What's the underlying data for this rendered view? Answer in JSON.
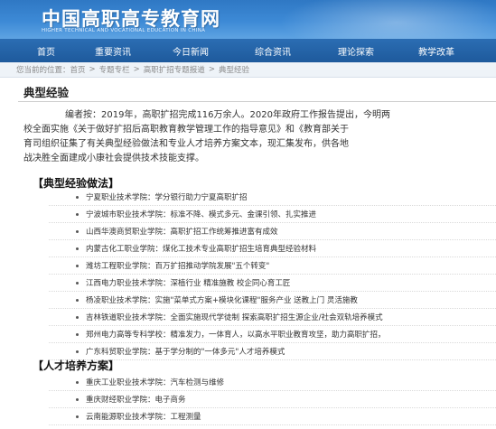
{
  "header": {
    "site_title": "中国高职高专教育网",
    "site_subtitle": "HIGHER TECHNICAL AND VOCATIONAL EDUCATION IN CHINA"
  },
  "nav": {
    "items": [
      {
        "label": "首页"
      },
      {
        "label": "重要资讯"
      },
      {
        "label": "今日新闻"
      },
      {
        "label": "综合资讯"
      },
      {
        "label": "理论探索"
      },
      {
        "label": "教学改革"
      }
    ]
  },
  "breadcrumb": {
    "prefix": "您当前的位置：",
    "crumbs": [
      "首页",
      "专题专栏",
      "高职扩招专题报道",
      "典型经验"
    ],
    "separator": ">"
  },
  "article": {
    "title": "典型经验",
    "intro_lines": [
      "编者按：2019年，高职扩招完成116万余人。2020年政府工作报告提出，今明两",
      "校全面实施《关于做好扩招后高职教育教学管理工作的指导意见》和《教育部关于",
      "育司组织征集了有关典型经验做法和专业人才培养方案文本，现汇集发布，供各地",
      "战决胜全面建成小康社会提供技术技能支撑。"
    ]
  },
  "sections": [
    {
      "heading": "【典型经验做法】",
      "items": [
        "宁夏职业技术学院：学分银行助力宁夏高职扩招",
        "宁波城市职业技术学院：标准不降、模式多元、金课引领、扎实推进",
        "山西华澳商贸职业学院：高职扩招工作统筹推进富有成效",
        "内蒙古化工职业学院：煤化工技术专业高职扩招生培育典型经验材料",
        "潍坊工程职业学院：百万扩招推动学院发展\"五个转变\"",
        "江西电力职业技术学院：深植行业 精准施教 校企同心育工匠",
        "杨凌职业技术学院：实施\"菜单式方案+模块化课程\"服务产业 送教上门 灵活施教",
        "吉林铁道职业技术学院：全面实施现代学徒制 探索高职扩招生源企业/社会双轨培养模式",
        "郑州电力高等专科学校：精准发力，一体育人，以高水平职业教育攻坚，助力高职扩招，",
        "广东科贸职业学院：基于学分制的\"一体多元\"人才培养模式"
      ]
    },
    {
      "heading": "【人才培养方案】",
      "items": [
        "重庆工业职业技术学院：汽车检测与维修",
        "重庆财经职业学院：电子商务",
        "云南能源职业技术学院：工程测量"
      ]
    }
  ],
  "colors": {
    "banner": "#3d8ad6",
    "navbar": "#2b6db3",
    "breadcrumb_bg": "#eef3f8"
  }
}
